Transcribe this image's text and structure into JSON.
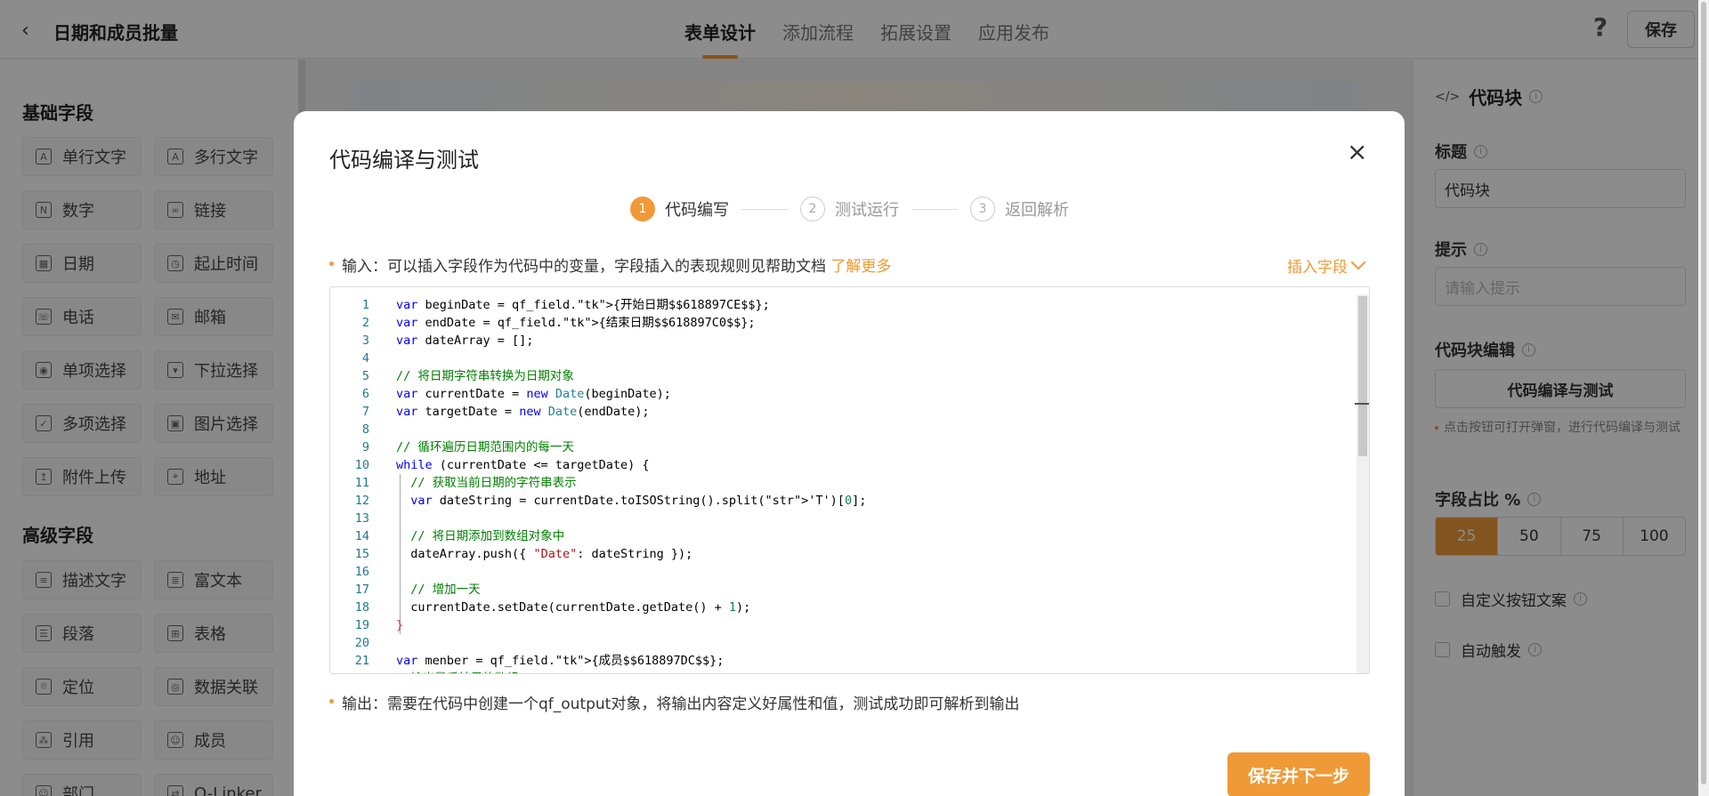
{
  "header": {
    "title": "日期和成员批量",
    "tabs": [
      {
        "label": "表单设计"
      },
      {
        "label": "添加流程"
      },
      {
        "label": "拓展设置"
      },
      {
        "label": "应用发布"
      }
    ],
    "help_icon": "?",
    "save_label": "保存"
  },
  "left_panel": {
    "basic_title": "基础字段",
    "basic_fields": [
      {
        "label": "单行文字",
        "icon": "A"
      },
      {
        "label": "多行文字",
        "icon": "A"
      },
      {
        "label": "数字",
        "icon": "N"
      },
      {
        "label": "链接",
        "icon": "∞"
      },
      {
        "label": "日期",
        "icon": "▦"
      },
      {
        "label": "起止时间",
        "icon": "◷"
      },
      {
        "label": "电话",
        "icon": "☏"
      },
      {
        "label": "邮箱",
        "icon": "✉"
      },
      {
        "label": "单项选择",
        "icon": "◉"
      },
      {
        "label": "下拉选择",
        "icon": "▾"
      },
      {
        "label": "多项选择",
        "icon": "✓"
      },
      {
        "label": "图片选择",
        "icon": "▣"
      },
      {
        "label": "附件上传",
        "icon": "↥"
      },
      {
        "label": "地址",
        "icon": "⌖"
      }
    ],
    "advanced_title": "高级字段",
    "advanced_fields": [
      {
        "label": "描述文字",
        "icon": "≡"
      },
      {
        "label": "富文本",
        "icon": "≣"
      },
      {
        "label": "段落",
        "icon": "☰"
      },
      {
        "label": "表格",
        "icon": "⊞"
      },
      {
        "label": "定位",
        "icon": "⌾"
      },
      {
        "label": "数据关联",
        "icon": "◎"
      },
      {
        "label": "引用",
        "icon": "⁂"
      },
      {
        "label": "成员",
        "icon": "☺"
      },
      {
        "label": "部门",
        "icon": "☺"
      },
      {
        "label": "Q-Linker",
        "icon": "⇄"
      }
    ]
  },
  "right_panel": {
    "title": "代码块",
    "title_label": "标题",
    "title_value": "代码块",
    "hint_label": "提示",
    "hint_placeholder": "请输入提示",
    "code_edit_label": "代码块编辑",
    "code_edit_button": "代码编译与测试",
    "code_edit_hint": "点击按钮可打开弹窗，进行代码编译与测试",
    "ratio_label": "字段占比 %",
    "ratio_options": [
      "25",
      "50",
      "75",
      "100"
    ],
    "ratio_selected": "25",
    "custom_button_text": "自定义按钮文案",
    "auto_trigger": "自动触发"
  },
  "modal": {
    "title": "代码编译与测试",
    "close_icon": "×",
    "steps": [
      {
        "num": "1",
        "label": "代码编写",
        "active": true
      },
      {
        "num": "2",
        "label": "测试运行",
        "active": false
      },
      {
        "num": "3",
        "label": "返回解析",
        "active": false
      }
    ],
    "input_note": "输入：可以插入字段作为代码中的变量，字段插入的表现规则见帮助文档 ",
    "learn_more": "了解更多",
    "insert_field": "插入字段",
    "output_note": "输出：需要在代码中创建一个qf_output对象，将输出内容定义好属性和值，测试成功即可解析到输出",
    "next_button": "保存并下一步",
    "code_lines": [
      "var beginDate = qf_field.{开始日期$$618897CE$$};",
      "var endDate = qf_field.{结束日期$$618897C0$$};",
      "var dateArray = [];",
      "",
      "// 将日期字符串转换为日期对象",
      "var currentDate = new Date(beginDate);",
      "var targetDate = new Date(endDate);",
      "",
      "// 循环遍历日期范围内的每一天",
      "while (currentDate <= targetDate) {",
      "  // 获取当前日期的字符串表示",
      "  var dateString = currentDate.toISOString().split('T')[0];",
      "",
      "  // 将日期添加到数组对象中",
      "  dateArray.push({ \"Date\": dateString });",
      "",
      "  // 增加一天",
      "  currentDate.setDate(currentDate.getDate() + 1);",
      "}",
      "",
      "var menber = qf_field.{成员$$618897DC$$};",
      "//输出最后结果的数组"
    ]
  }
}
